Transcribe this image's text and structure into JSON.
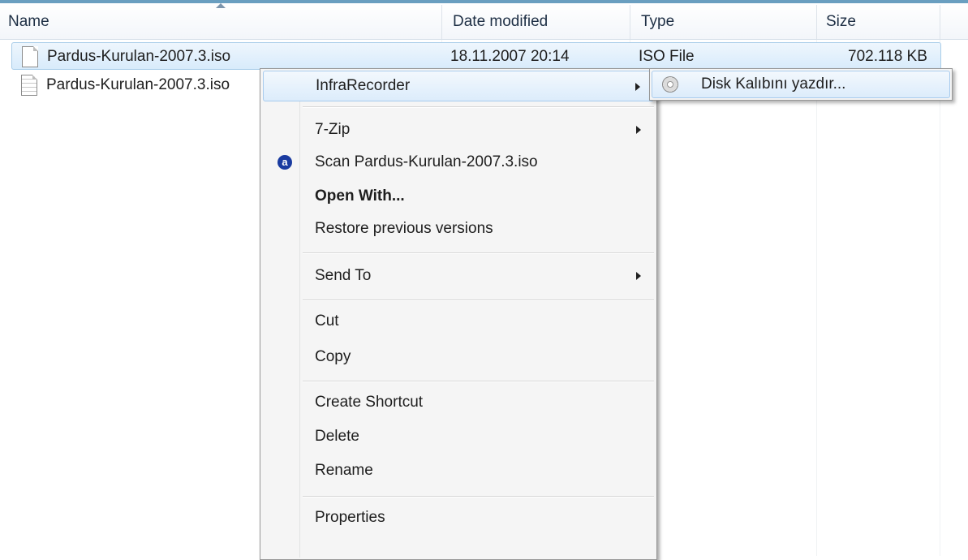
{
  "columns": {
    "name": "Name",
    "date_modified": "Date modified",
    "type": "Type",
    "size": "Size"
  },
  "files": [
    {
      "name": "Pardus-Kurulan-2007.3.iso",
      "date_modified": "18.11.2007 20:14",
      "type": "ISO File",
      "size": "702.118 KB",
      "icon": "blank-file-icon",
      "selected": true
    },
    {
      "name": "Pardus-Kurulan-2007.3.iso",
      "icon": "text-file-icon",
      "selected": false
    }
  ],
  "context_menu": {
    "infrarecorder": "InfraRecorder",
    "sevenzip": "7-Zip",
    "scan": "Scan Pardus-Kurulan-2007.3.iso",
    "open_with": "Open With...",
    "restore": "Restore previous versions",
    "send_to": "Send To",
    "cut": "Cut",
    "copy": "Copy",
    "create_shortcut": "Create Shortcut",
    "delete": "Delete",
    "rename": "Rename",
    "properties": "Properties"
  },
  "submenu": {
    "burn_image": "Disk Kalıbını yazdır..."
  },
  "icons": {
    "scan": "antivirus-scan-icon",
    "burn": "disc-icon"
  }
}
